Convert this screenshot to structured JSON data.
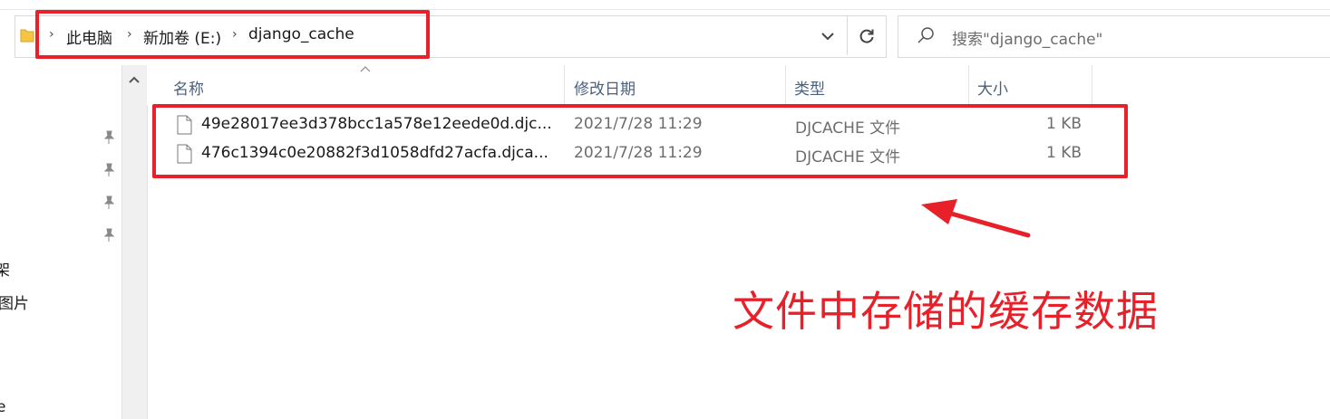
{
  "breadcrumbs": [
    {
      "label": "此电脑"
    },
    {
      "label": "新加卷 (E:)"
    },
    {
      "label": "django_cache"
    }
  ],
  "search": {
    "placeholder": "搜索\"django_cache\""
  },
  "nav_pane": {
    "fragments": [
      "架",
      "图片",
      "e"
    ]
  },
  "columns": [
    {
      "label": "名称"
    },
    {
      "label": "修改日期"
    },
    {
      "label": "类型"
    },
    {
      "label": "大小"
    }
  ],
  "files": [
    {
      "name": "49e28017ee3d378bcc1a578e12eede0d.djc...",
      "modified": "2021/7/28 11:29",
      "type": "DJCACHE 文件",
      "size": "1 KB"
    },
    {
      "name": "476c1394c0e20882f3d1058dfd27acfa.djca...",
      "modified": "2021/7/28 11:29",
      "type": "DJCACHE 文件",
      "size": "1 KB"
    }
  ],
  "annotation": {
    "text": "文件中存储的缓存数据",
    "color": "#e8202a"
  },
  "colors": {
    "header_text": "#4c607a",
    "secondary_text": "#6d6d6d",
    "folder_yellow": "#f5c542",
    "annotation_red": "#e8202a"
  },
  "icons": [
    "folder-icon",
    "chevron-right-icon",
    "chevron-down-icon",
    "refresh-icon",
    "search-icon",
    "pin-icon",
    "chevron-up-icon",
    "file-icon",
    "arrow-icon"
  ]
}
